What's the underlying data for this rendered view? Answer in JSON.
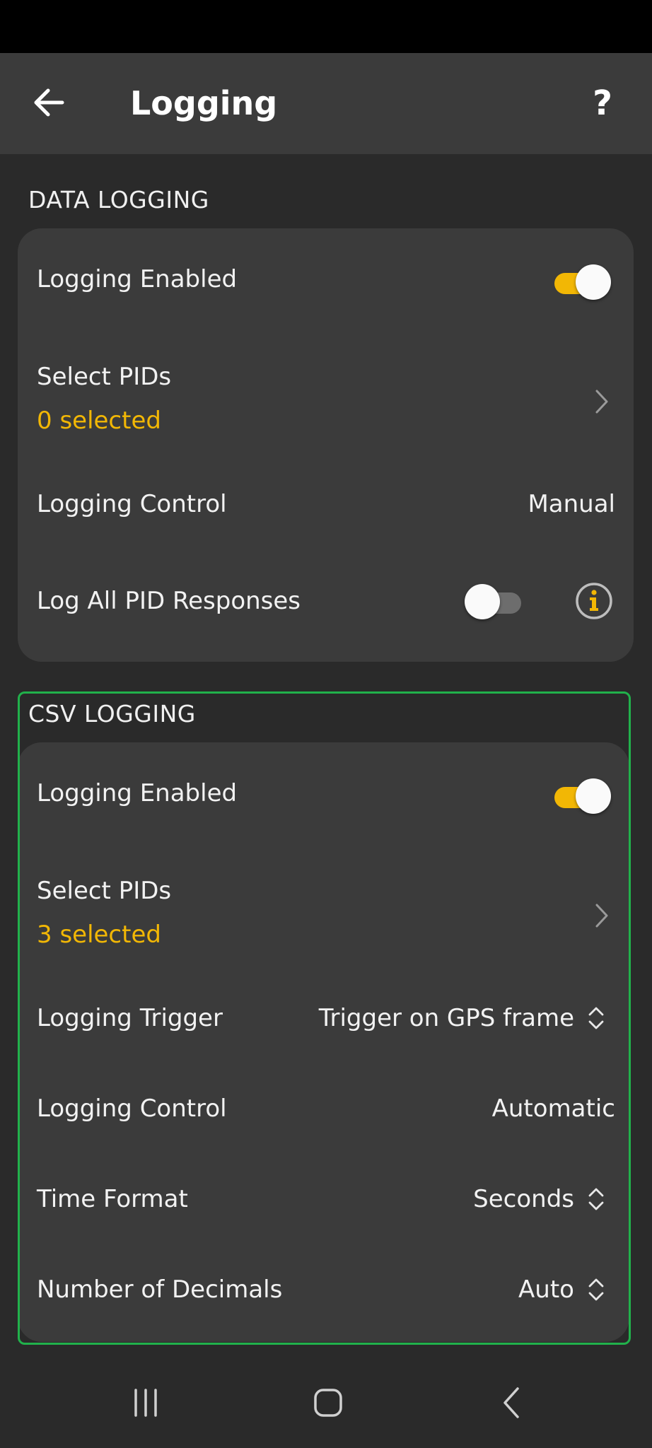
{
  "app_bar": {
    "title": "Logging",
    "help_label": "?",
    "back_icon": "arrow-left-icon"
  },
  "data_logging": {
    "header": "DATA LOGGING",
    "logging_enabled": {
      "label": "Logging Enabled",
      "state": "on"
    },
    "select_pids": {
      "label": "Select PIDs",
      "count_text": "0 selected"
    },
    "logging_control": {
      "label": "Logging Control",
      "value": "Manual"
    },
    "log_all_pid_responses": {
      "label": "Log All PID Responses",
      "state": "off"
    }
  },
  "csv_logging": {
    "header": "CSV LOGGING",
    "logging_enabled": {
      "label": "Logging Enabled",
      "state": "on"
    },
    "select_pids": {
      "label": "Select PIDs",
      "count_text": "3 selected"
    },
    "logging_trigger": {
      "label": "Logging Trigger",
      "value": "Trigger on GPS frame"
    },
    "logging_control": {
      "label": "Logging Control",
      "value": "Automatic"
    },
    "time_format": {
      "label": "Time Format",
      "value": "Seconds"
    },
    "number_of_decimals": {
      "label": "Number of Decimals",
      "value": "Auto"
    }
  },
  "colors": {
    "accent": "#f2b705",
    "background": "#2a2a2a",
    "card": "#3b3b3b",
    "highlight": "#21b14b"
  },
  "nav_bar": {
    "recents_icon": "recents-icon",
    "home_icon": "home-icon",
    "back_icon": "back-chevron-icon"
  }
}
